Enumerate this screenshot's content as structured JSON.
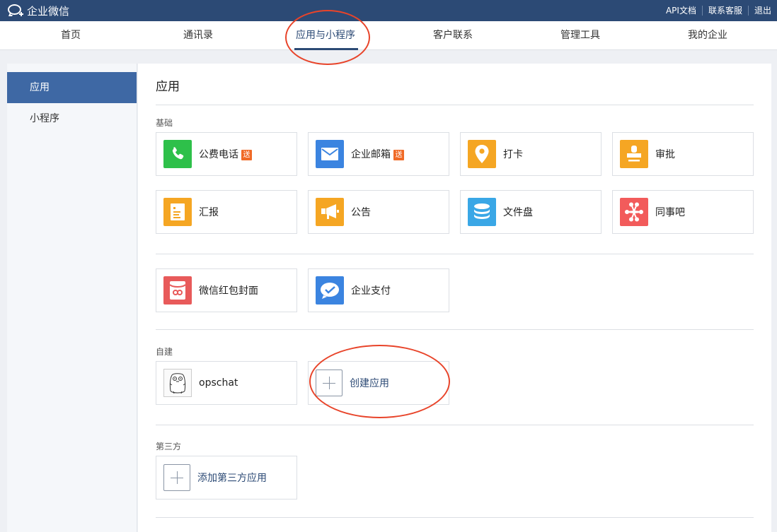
{
  "topbar": {
    "brand": "企业微信",
    "links": [
      "API文档",
      "联系客服",
      "退出"
    ]
  },
  "nav": {
    "tabs": [
      "首页",
      "通讯录",
      "应用与小程序",
      "客户联系",
      "管理工具",
      "我的企业"
    ],
    "active": "应用与小程序"
  },
  "sidebar": {
    "items": [
      "应用",
      "小程序"
    ],
    "active": "应用"
  },
  "main": {
    "title": "应用",
    "sections": {
      "basic": "基础",
      "custom": "自建",
      "third_party": "第三方"
    },
    "basic_apps": [
      {
        "label": "公费电话",
        "badge": "送",
        "icon": "phone-icon",
        "color": "#2ec04a"
      },
      {
        "label": "企业邮箱",
        "badge": "送",
        "icon": "mail-icon",
        "color": "#3b84e0"
      },
      {
        "label": "打卡",
        "icon": "location-pin-icon",
        "color": "#f5a623"
      },
      {
        "label": "审批",
        "icon": "stamp-icon",
        "color": "#f5a623"
      },
      {
        "label": "汇报",
        "icon": "report-icon",
        "color": "#f5a623"
      },
      {
        "label": "公告",
        "icon": "megaphone-icon",
        "color": "#f5a623"
      },
      {
        "label": "文件盘",
        "icon": "database-icon",
        "color": "#3aa7e6"
      },
      {
        "label": "同事吧",
        "icon": "network-icon",
        "color": "#f25b5b"
      }
    ],
    "extra_apps": [
      {
        "label": "微信红包封面",
        "icon": "red-packet-icon",
        "color": "#e85a5a"
      },
      {
        "label": "企业支付",
        "icon": "payment-icon",
        "color": "#3b84e0"
      }
    ],
    "custom_apps": [
      {
        "label": "opschat",
        "icon": "gopher-avatar-icon"
      },
      {
        "label": "创建应用",
        "icon": "plus-icon"
      }
    ],
    "third_party_apps": [
      {
        "label": "添加第三方应用",
        "icon": "plus-icon"
      }
    ]
  }
}
